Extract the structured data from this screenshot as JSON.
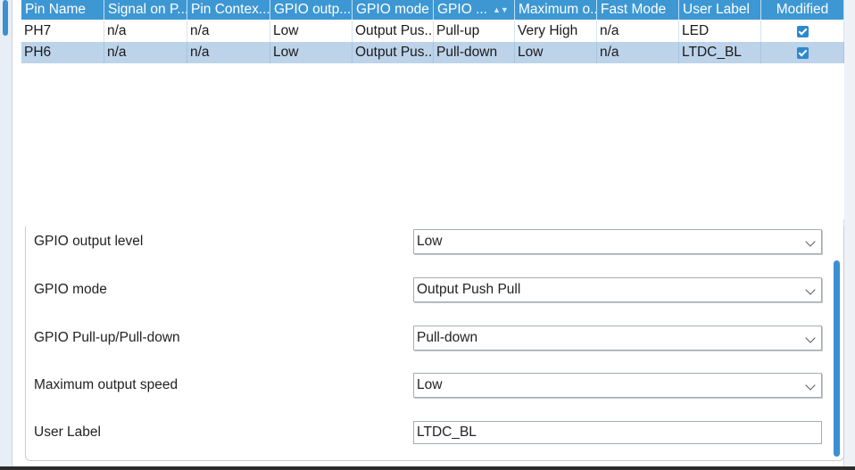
{
  "table": {
    "columns": [
      {
        "label": "Pin Name"
      },
      {
        "label": "Signal on P..."
      },
      {
        "label": "Pin Contex..."
      },
      {
        "label": "GPIO outp..."
      },
      {
        "label": "GPIO mode"
      },
      {
        "label": "GPIO ..."
      },
      {
        "label": "Maximum o..."
      },
      {
        "label": "Fast Mode"
      },
      {
        "label": "User Label"
      },
      {
        "label": "Modified"
      }
    ],
    "rows": [
      {
        "pin": "PH7",
        "signal": "n/a",
        "context": "n/a",
        "output": "Low",
        "mode": "Output Pus...",
        "pull": "Pull-up",
        "speed": "Very High",
        "fast": "n/a",
        "label": "LED",
        "modified": true
      },
      {
        "pin": "PH6",
        "signal": "n/a",
        "context": "n/a",
        "output": "Low",
        "mode": "Output Pus...",
        "pull": "Pull-down",
        "speed": "Low",
        "fast": "n/a",
        "label": "LTDC_BL",
        "modified": true
      }
    ]
  },
  "properties": {
    "output_level": {
      "label": "GPIO output level",
      "value": "Low"
    },
    "mode": {
      "label": "GPIO mode",
      "value": "Output Push Pull"
    },
    "pull": {
      "label": "GPIO Pull-up/Pull-down",
      "value": "Pull-down"
    },
    "speed": {
      "label": "Maximum output speed",
      "value": "Low"
    },
    "user_label": {
      "label": "User Label",
      "value": "LTDC_BL"
    }
  },
  "colors": {
    "header_bg": "#3d97d3",
    "selected_row": "#bcd3ea",
    "checkbox": "#2d89cf"
  }
}
